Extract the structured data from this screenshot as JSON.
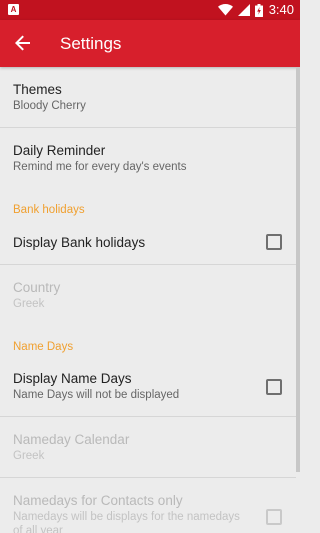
{
  "status_bar": {
    "app_icon_letter": "A",
    "time": "3:40",
    "battery_level": "charging"
  },
  "toolbar": {
    "title": "Settings",
    "back_icon": "arrow-back-icon"
  },
  "preferences": {
    "themes": {
      "title": "Themes",
      "summary": "Bloody Cherry"
    },
    "daily_reminder": {
      "title": "Daily Reminder",
      "summary": "Remind me for every day's events"
    },
    "bank_holidays_category": "Bank holidays",
    "display_bank_holidays": {
      "title": "Display Bank holidays",
      "checked": false
    },
    "country": {
      "title": "Country",
      "summary": "Greek",
      "enabled": false
    },
    "name_days_category": "Name Days",
    "display_name_days": {
      "title": "Display Name Days",
      "summary": "Name Days will not be displayed",
      "checked": false
    },
    "nameday_calendar": {
      "title": "Nameday Calendar",
      "summary": "Greek",
      "enabled": false
    },
    "namedays_contacts_only": {
      "title": "Namedays for Contacts only",
      "summary_line1": "Namedays will be displays for the namedays",
      "summary_line2": "of all year",
      "checked": false,
      "enabled": false
    }
  },
  "colors": {
    "status_bar": "#c1121f",
    "toolbar": "#d71f2c",
    "background": "#ececec",
    "category_accent": "#f0a030"
  }
}
